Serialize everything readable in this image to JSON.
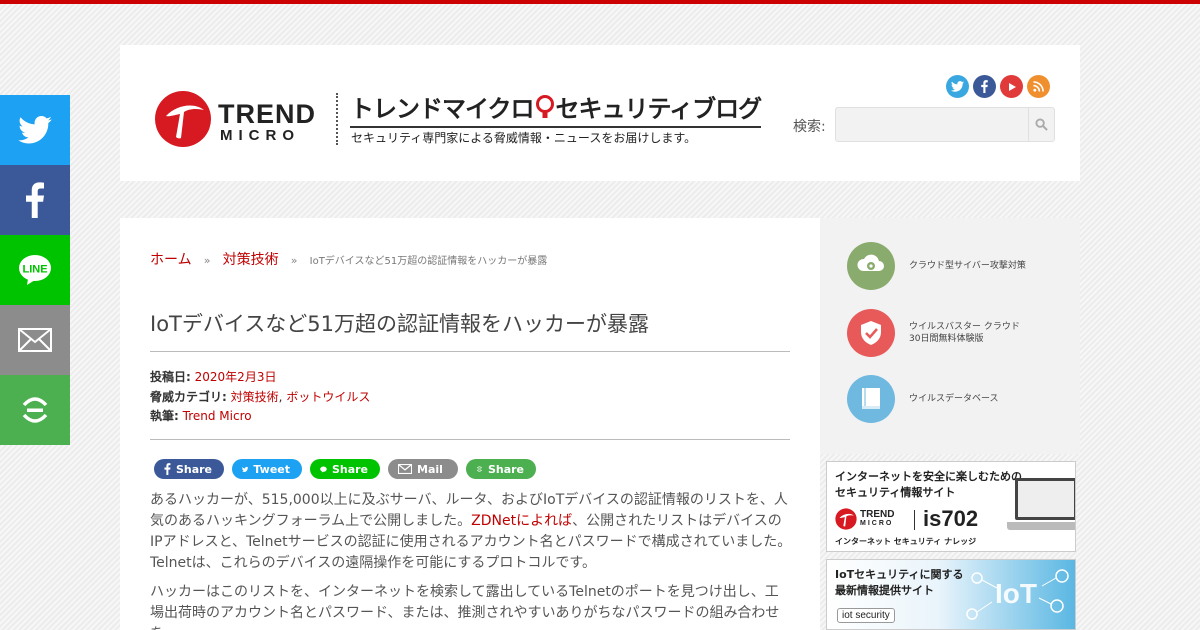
{
  "left_share": {
    "items": [
      "twitter",
      "facebook",
      "line",
      "mail",
      "more"
    ],
    "line_label": "LINE"
  },
  "header": {
    "logo_l1": "TREND",
    "logo_l2": "MICRO",
    "blog_title": "トレンドマイクロ",
    "blog_title2": "セキュリティブログ",
    "blog_subtitle": "セキュリティ専門家による脅威情報・ニュースをお届けします。",
    "social_icons": [
      "twitter-icon",
      "facebook-icon",
      "youtube-icon",
      "rss-icon"
    ],
    "search_label": "検索:",
    "search_value": ""
  },
  "breadcrumb": {
    "home": "ホーム",
    "category": "対策技術",
    "separator": "»",
    "current": "IoTデバイスなど51万超の認証情報をハッカーが暴露"
  },
  "post": {
    "title": "IoTデバイスなど51万超の認証情報をハッカーが暴露",
    "posted_label": "投稿日:",
    "posted_date": "2020年2月3日",
    "threat_label": "脅威カテゴリ:",
    "threat_cat1": "対策技術",
    "threat_sep": ",",
    "threat_cat2": "ボットウイルス",
    "author_label": "執筆:",
    "author": "Trend Micro"
  },
  "share_buttons": [
    {
      "label": "Share",
      "service": "facebook"
    },
    {
      "label": "Tweet",
      "service": "twitter"
    },
    {
      "label": "Share",
      "service": "line"
    },
    {
      "label": "Mail",
      "service": "mail"
    },
    {
      "label": "Share",
      "service": "more"
    }
  ],
  "body": {
    "p1_a": "あるハッカーが、515,000以上に及ぶサーバ、ルータ、およびIoTデバイスの認証情報のリストを、人気のあるハッキングフォーラム上で公開しました。",
    "p1_link": "ZDNetによれば",
    "p1_b": "、公開されたリストはデバイスのIPアドレスと、Telnetサービスの認証に使用されるアカウント名とパスワードで構成されていました。Telnetは、これらのデバイスの遠隔操作を可能にするプロトコルです。",
    "p2": "ハッカーはこのリストを、インターネットを検索して露出しているTelnetのポートを見つけ出し、工場出荷時のアカウント名とパスワード、または、推測されやすいありがちなパスワードの組み合わせを"
  },
  "sidebar": {
    "items": [
      {
        "label": "クラウド型サイバー攻撃対策",
        "icon": "cloud-virus-icon",
        "color": "#8aab6e"
      },
      {
        "label": "ウイルスバスター クラウド",
        "label2": "30日間無料体験版",
        "icon": "shield-check-icon",
        "color": "#e85a5a"
      },
      {
        "label": "ウイルスデータベース",
        "icon": "book-icon",
        "color": "#6fb8e0"
      }
    ],
    "banner1": {
      "line1": "インターネットを安全に楽しむための",
      "line2": "セキュリティ情報サイト",
      "brand": "TREND",
      "brand2": "MICRO",
      "site": "is702",
      "tagline": "インターネット セキュリティ ナレッジ"
    },
    "banner2": {
      "line1": "IoTセキュリティに関する",
      "line2": "最新情報提供サイト",
      "logo": "iot security",
      "big": "IoT"
    }
  }
}
